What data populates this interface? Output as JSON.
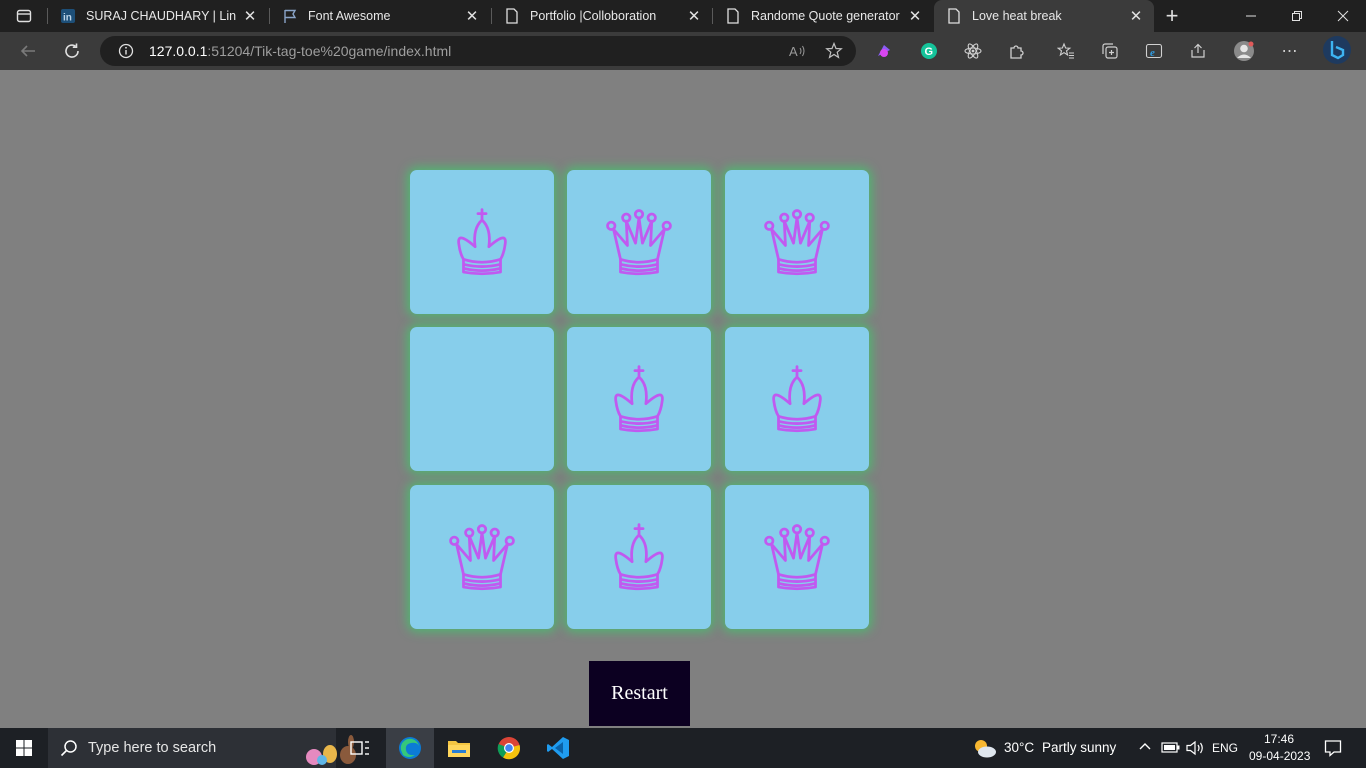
{
  "browser": {
    "tabs": [
      {
        "title": "SURAJ CHAUDHARY | LinkedIn",
        "favicon": "linkedin-icon",
        "active": false
      },
      {
        "title": "Font Awesome",
        "favicon": "flag-icon",
        "active": false
      },
      {
        "title": "Portfolio |Colloboration",
        "favicon": "page-icon",
        "active": false
      },
      {
        "title": "Randome Quote generator",
        "favicon": "page-icon",
        "active": false
      },
      {
        "title": "Love heat break",
        "favicon": "page-icon",
        "active": true
      }
    ],
    "new_tab": "+",
    "address": {
      "host": "127.0.0.1",
      "path": ":51204/Tik-tag-toe%20game/index.html"
    }
  },
  "game": {
    "cells": [
      "king",
      "queen",
      "queen",
      "",
      "king",
      "king",
      "queen",
      "king",
      "queen"
    ],
    "piece_color": "#c05af0",
    "cell_color": "#87ceeb",
    "glow_color": "#49be6e",
    "restart_label": "Restart"
  },
  "taskbar": {
    "search_placeholder": "Type here to search",
    "weather": {
      "temp": "30°C",
      "desc": "Partly sunny"
    },
    "language": "ENG",
    "time": "17:46",
    "date": "09-04-2023"
  },
  "colors": {
    "page_bg": "#808080",
    "restart_bg": "#0c0021"
  }
}
